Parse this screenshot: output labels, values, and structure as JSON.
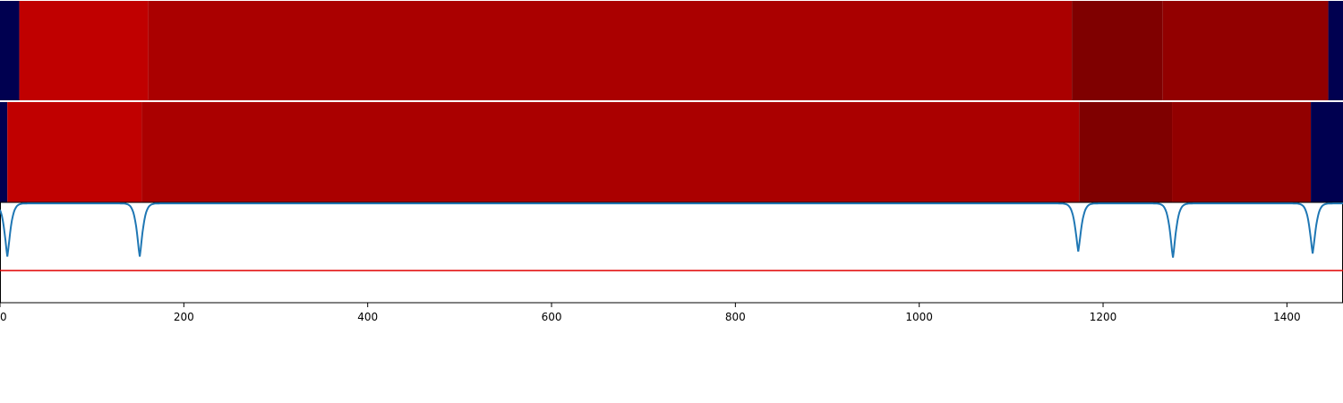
{
  "chart_data": {
    "type": "heatmap",
    "x_range": [
      0,
      1461
    ],
    "x_ticks": [
      0,
      200,
      400,
      600,
      800,
      1000,
      1200,
      1400
    ],
    "x_tick_labels": [
      "0",
      "200",
      "400",
      "600",
      "800",
      "1000",
      "1200",
      "1400"
    ],
    "colors": {
      "background": "#000050",
      "level_bright": "#c00000",
      "level_mid": "#aa0000",
      "level_dark": "#7f0000",
      "level_darker": "#920000",
      "line": "#1f77b4",
      "threshold": "#e00000"
    },
    "strips": [
      {
        "segments": [
          {
            "x0": 0,
            "x1": 21,
            "color": "#000050"
          },
          {
            "x0": 21,
            "x1": 161,
            "color": "#c00000"
          },
          {
            "x0": 161,
            "x1": 1166,
            "color": "#aa0000"
          },
          {
            "x0": 1166,
            "x1": 1265,
            "color": "#7f0000"
          },
          {
            "x0": 1265,
            "x1": 1445,
            "color": "#920000"
          },
          {
            "x0": 1445,
            "x1": 1461,
            "color": "#000050"
          }
        ]
      },
      {
        "segments": [
          {
            "x0": 0,
            "x1": 8,
            "color": "#000050"
          },
          {
            "x0": 8,
            "x1": 154,
            "color": "#c00000"
          },
          {
            "x0": 154,
            "x1": 1174,
            "color": "#aa0000"
          },
          {
            "x0": 1174,
            "x1": 1275,
            "color": "#7f0000"
          },
          {
            "x0": 1275,
            "x1": 1426,
            "color": "#920000"
          },
          {
            "x0": 1426,
            "x1": 1461,
            "color": "#000050"
          }
        ]
      }
    ],
    "signal": {
      "y_range": [
        0,
        1
      ],
      "baseline": 0.99,
      "dips": [
        {
          "x": 8,
          "depth": 0.53
        },
        {
          "x": 152,
          "depth": 0.53
        },
        {
          "x": 1173,
          "depth": 0.48
        },
        {
          "x": 1276,
          "depth": 0.54
        },
        {
          "x": 1428,
          "depth": 0.5
        }
      ],
      "threshold": 0.32
    }
  }
}
